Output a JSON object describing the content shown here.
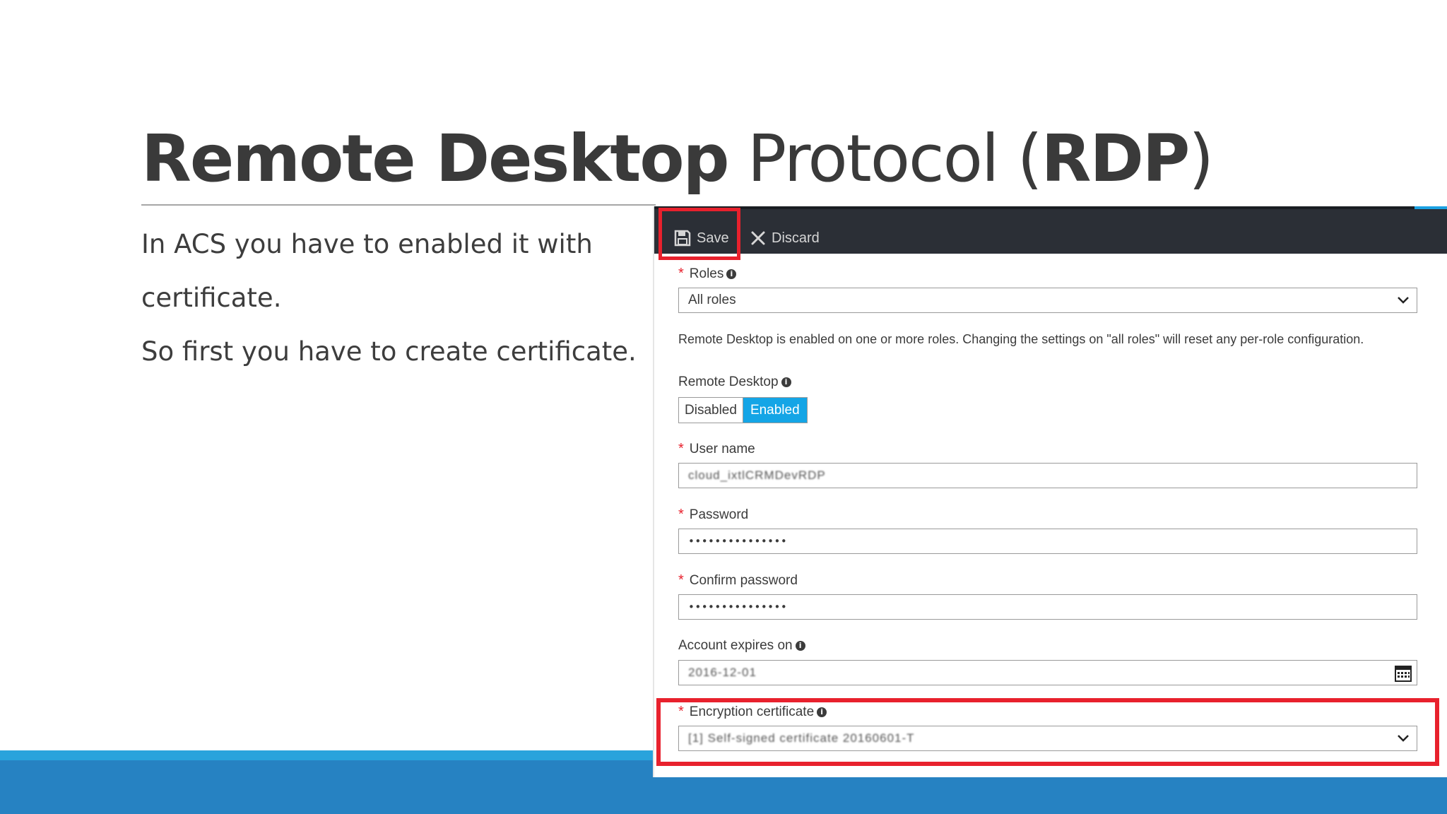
{
  "slide": {
    "title_bold_1": "Remote Desktop",
    "title_light": "Protocol (",
    "title_bold_2": "RDP",
    "title_light_end": ")",
    "body": [
      "In ACS you have to enabled it with",
      "certificate.",
      "So first you have to create certificate."
    ]
  },
  "toolbar": {
    "save_label": "Save",
    "discard_label": "Discard",
    "save_icon": "floppy-disk-icon",
    "discard_icon": "x-icon"
  },
  "form": {
    "roles": {
      "label": "Roles",
      "value": "All roles",
      "required": "*"
    },
    "note": "Remote Desktop is enabled on one or more roles. Changing the settings on \"all roles\" will reset any per-role configuration.",
    "remote_desktop": {
      "label": "Remote Desktop",
      "options": [
        "Disabled",
        "Enabled"
      ],
      "selected": "Enabled"
    },
    "user_name": {
      "label": "User name",
      "value": "cloud_ixtlCRMDevRDP",
      "required": "*"
    },
    "password": {
      "label": "Password",
      "value": "•••••••••••••••",
      "required": "*"
    },
    "confirm_password": {
      "label": "Confirm password",
      "value": "•••••••••••••••",
      "required": "*"
    },
    "account_expires": {
      "label": "Account expires on",
      "value": "2016-12-01"
    },
    "encryption_certificate": {
      "label": "Encryption certificate",
      "value": "[1] Self-signed certificate 20160601-T",
      "required": "*"
    }
  },
  "colors": {
    "highlight": "#e8212d",
    "toggle_on": "#14a5e6",
    "toolbar_bg": "#2b2f36",
    "band_main": "#2682c2",
    "band_top": "#29a3dc"
  }
}
